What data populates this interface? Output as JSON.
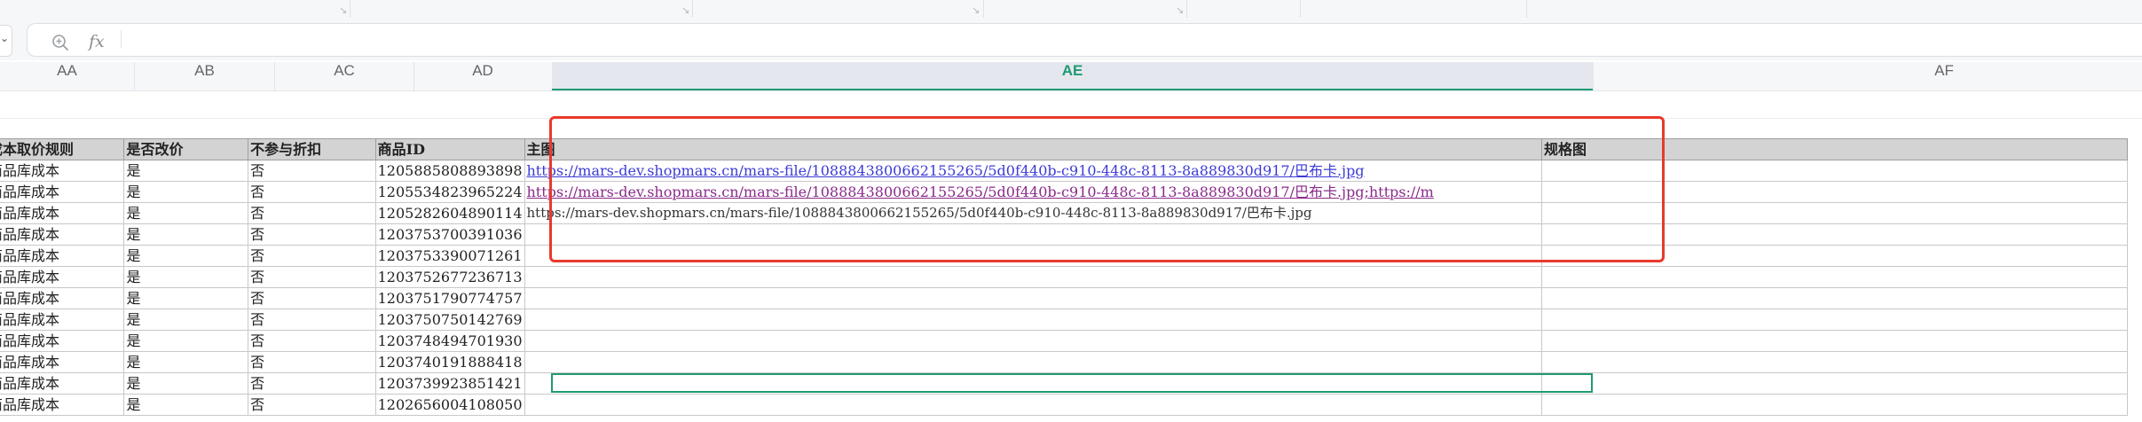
{
  "formula_bar": {
    "zoom_icon": "zoom-in-icon",
    "fx_label": "fx",
    "value": ""
  },
  "columns": [
    "AA",
    "AB",
    "AC",
    "AD",
    "AE",
    "AF"
  ],
  "selected_column": "AE",
  "headers": {
    "rule": "成本取价规则",
    "price_changed": "是否改价",
    "no_discount": "不参与折扣",
    "product_id": "商品ID",
    "main_image": "主图",
    "spec_image": "规格图"
  },
  "rows": [
    {
      "rule": "商品库成本",
      "price_changed": "是",
      "no_discount": "否",
      "product_id": "1205885808893898",
      "main_image": "https://mars-dev.shopmars.cn/mars-file/1088843800662155265/5d0f440b-c910-448c-8113-8a889830d917/巴布卡.jpg",
      "image_style": "link"
    },
    {
      "rule": "商品库成本",
      "price_changed": "是",
      "no_discount": "否",
      "product_id": "1205534823965224",
      "main_image": "https://mars-dev.shopmars.cn/mars-file/1088843800662155265/5d0f440b-c910-448c-8113-8a889830d917/巴布卡.jpg;https://m",
      "image_style": "link-visited"
    },
    {
      "rule": "商品库成本",
      "price_changed": "是",
      "no_discount": "否",
      "product_id": "1205282604890114",
      "main_image": "https://mars-dev.shopmars.cn/mars-file/1088843800662155265/5d0f440b-c910-448c-8113-8a889830d917/巴布卡.jpg",
      "image_style": "plain"
    },
    {
      "rule": "商品库成本",
      "price_changed": "是",
      "no_discount": "否",
      "product_id": "1203753700391036",
      "main_image": "",
      "image_style": "plain"
    },
    {
      "rule": "商品库成本",
      "price_changed": "是",
      "no_discount": "否",
      "product_id": "1203753390071261",
      "main_image": "",
      "image_style": "plain"
    },
    {
      "rule": "商品库成本",
      "price_changed": "是",
      "no_discount": "否",
      "product_id": "1203752677236713",
      "main_image": "",
      "image_style": "plain"
    },
    {
      "rule": "商品库成本",
      "price_changed": "是",
      "no_discount": "否",
      "product_id": "1203751790774757",
      "main_image": "",
      "image_style": "plain"
    },
    {
      "rule": "商品库成本",
      "price_changed": "是",
      "no_discount": "否",
      "product_id": "1203750750142769",
      "main_image": "",
      "image_style": "plain"
    },
    {
      "rule": "商品库成本",
      "price_changed": "是",
      "no_discount": "否",
      "product_id": "1203748494701930",
      "main_image": "",
      "image_style": "plain"
    },
    {
      "rule": "商品库成本",
      "price_changed": "是",
      "no_discount": "否",
      "product_id": "1203740191888418",
      "main_image": "",
      "image_style": "plain"
    },
    {
      "rule": "商品库成本",
      "price_changed": "是",
      "no_discount": "否",
      "product_id": "1203739923851421",
      "main_image": "",
      "image_style": "plain"
    },
    {
      "rule": "商品库成本",
      "price_changed": "是",
      "no_discount": "否",
      "product_id": "1202656004108050",
      "main_image": "",
      "image_style": "plain"
    }
  ],
  "colors": {
    "selection": "#1f9a73",
    "annotation": "#e8392c",
    "link": "#3b3bd6",
    "visited_link": "#8a2a8a",
    "header_fill": "#d3d3d3"
  }
}
